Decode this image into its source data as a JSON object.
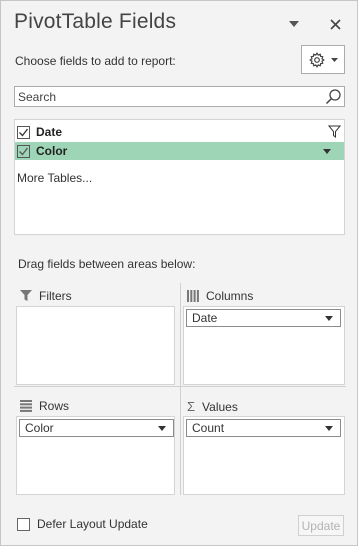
{
  "header": {
    "title": "PivotTable Fields",
    "dropdown_icon": "chevron-down-icon",
    "close_icon": "close-icon"
  },
  "fields_section": {
    "choose_label": "Choose fields to add to report:",
    "settings_icon": "gear-icon",
    "search_placeholder": "Search",
    "fields": [
      {
        "label": "Date",
        "checked": true,
        "selected": false,
        "right_icon": "filter-icon"
      },
      {
        "label": "Color",
        "checked": true,
        "selected": true,
        "right_icon": "dropdown-arrow-icon"
      }
    ],
    "more_tables": "More Tables..."
  },
  "areas_section": {
    "drag_label": "Drag fields between areas below:",
    "filters": {
      "label": "Filters",
      "items": []
    },
    "columns": {
      "label": "Columns",
      "items": [
        "Date"
      ]
    },
    "rows": {
      "label": "Rows",
      "items": [
        "Color"
      ]
    },
    "values": {
      "label": "Values",
      "items": [
        "Count"
      ]
    }
  },
  "footer": {
    "defer_label": "Defer Layout Update",
    "defer_checked": false,
    "update_label": "Update"
  },
  "colors": {
    "selected_row": "#9fd5b7",
    "pane_background": "#f3f3f3"
  }
}
